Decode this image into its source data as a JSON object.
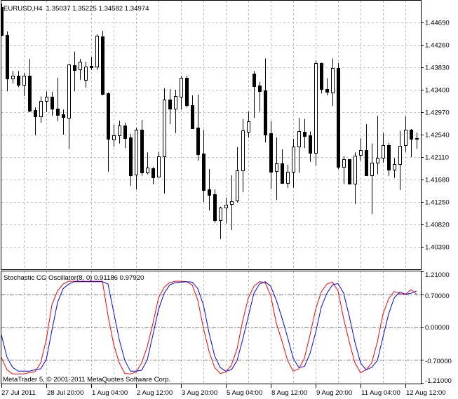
{
  "window": {
    "main_title": "EURUSD,H4  1.35037 1.35225 1.34582 1.34974",
    "indicator_title": "Stochastic CG Oscillator(8, 0) 0.91186 0.97920",
    "copyright": "MetaTrader 5, © 2001-2011 MetaQuotes Software Corp."
  },
  "colors": {
    "background": "#ffffff",
    "bull_body": "#ffffff",
    "bear_body": "#000000",
    "candle_outline": "#000000",
    "grid": "#c0c0c0",
    "level_lines": "#808080",
    "main_line": "#ff0000",
    "signal_line": "#0000ff"
  },
  "chart_data": [
    {
      "type": "candlestick",
      "symbol": "EURUSD",
      "timeframe": "H4",
      "grid": true,
      "y_axis_position": "right",
      "ylim": [
        1.4039,
        1.4512
      ],
      "y_ticks": [
        "1.44690",
        "1.44260",
        "1.43830",
        "1.43400",
        "1.42970",
        "1.42540",
        "1.42110",
        "1.41680",
        "1.41250",
        "1.40820",
        "1.40390"
      ],
      "x_ticks": [
        "27 Jul 2011",
        "28 Jul 20:00",
        "1 Aug 04:00",
        "2 Aug 12:00",
        "3 Aug 20:00",
        "5 Aug 04:00",
        "8 Aug 12:00",
        "9 Aug 20:00",
        "11 Aug 04:00",
        "12 Aug 12:00"
      ],
      "columns": [
        "open",
        "high",
        "low",
        "close"
      ],
      "candles": [
        [
          1.4499,
          1.4505,
          1.4443,
          1.4445
        ],
        [
          1.4445,
          1.4452,
          1.4337,
          1.4362
        ],
        [
          1.4362,
          1.4376,
          1.4352,
          1.4367
        ],
        [
          1.4367,
          1.4376,
          1.4345,
          1.4349
        ],
        [
          1.4349,
          1.4372,
          1.4328,
          1.4367
        ],
        [
          1.4367,
          1.4399,
          1.4297,
          1.43
        ],
        [
          1.4301,
          1.4306,
          1.4253,
          1.4289
        ],
        [
          1.4289,
          1.4327,
          1.4277,
          1.4319
        ],
        [
          1.4319,
          1.4337,
          1.4297,
          1.4327
        ],
        [
          1.4327,
          1.4336,
          1.429,
          1.4304
        ],
        [
          1.4304,
          1.4363,
          1.428,
          1.4292
        ],
        [
          1.4293,
          1.4302,
          1.4254,
          1.4288
        ],
        [
          1.4286,
          1.439,
          1.4227,
          1.4388
        ],
        [
          1.4387,
          1.4413,
          1.4337,
          1.4378
        ],
        [
          1.4379,
          1.4399,
          1.4359,
          1.4394
        ],
        [
          1.4359,
          1.4394,
          1.4344,
          1.4384
        ],
        [
          1.4386,
          1.4403,
          1.4378,
          1.4383
        ],
        [
          1.4384,
          1.4446,
          1.4378,
          1.4443
        ],
        [
          1.4442,
          1.4453,
          1.4329,
          1.4332
        ],
        [
          1.4333,
          1.4335,
          1.4183,
          1.4245
        ],
        [
          1.4245,
          1.4273,
          1.4231,
          1.4253
        ],
        [
          1.4252,
          1.4281,
          1.4237,
          1.4271
        ],
        [
          1.4271,
          1.4277,
          1.4228,
          1.4247
        ],
        [
          1.4249,
          1.4255,
          1.4156,
          1.4177
        ],
        [
          1.4177,
          1.4267,
          1.4149,
          1.4263
        ],
        [
          1.4263,
          1.4282,
          1.4175,
          1.4181
        ],
        [
          1.4181,
          1.422,
          1.4178,
          1.4191
        ],
        [
          1.419,
          1.4192,
          1.4159,
          1.4173
        ],
        [
          1.4173,
          1.4221,
          1.4172,
          1.4212
        ],
        [
          1.4212,
          1.4343,
          1.4141,
          1.4321
        ],
        [
          1.4321,
          1.4341,
          1.4274,
          1.4304
        ],
        [
          1.4304,
          1.434,
          1.4257,
          1.4328
        ],
        [
          1.4327,
          1.4366,
          1.4302,
          1.4363
        ],
        [
          1.4363,
          1.4367,
          1.4306,
          1.431
        ],
        [
          1.431,
          1.4329,
          1.4265,
          1.4266
        ],
        [
          1.4267,
          1.4331,
          1.4204,
          1.4216
        ],
        [
          1.4218,
          1.4263,
          1.4125,
          1.4148
        ],
        [
          1.4149,
          1.4188,
          1.4109,
          1.4138
        ],
        [
          1.414,
          1.4149,
          1.4085,
          1.409
        ],
        [
          1.409,
          1.4116,
          1.4054,
          1.4114
        ],
        [
          1.4113,
          1.4133,
          1.4084,
          1.4119
        ],
        [
          1.4121,
          1.4176,
          1.4071,
          1.4126
        ],
        [
          1.4128,
          1.423,
          1.4124,
          1.4186
        ],
        [
          1.4186,
          1.4284,
          1.4144,
          1.4262
        ],
        [
          1.426,
          1.4298,
          1.4248,
          1.428
        ],
        [
          1.4371,
          1.4376,
          1.4286,
          1.4347
        ],
        [
          1.4348,
          1.4355,
          1.4298,
          1.4337
        ],
        [
          1.4339,
          1.44,
          1.4239,
          1.4255
        ],
        [
          1.4257,
          1.428,
          1.415,
          1.4183
        ],
        [
          1.4184,
          1.4249,
          1.4129,
          1.4199
        ],
        [
          1.4199,
          1.4226,
          1.4161,
          1.4161
        ],
        [
          1.4162,
          1.4196,
          1.4152,
          1.4183
        ],
        [
          1.4183,
          1.4246,
          1.4152,
          1.4231
        ],
        [
          1.4231,
          1.4286,
          1.4181,
          1.4261
        ],
        [
          1.426,
          1.4284,
          1.4228,
          1.4252
        ],
        [
          1.4252,
          1.426,
          1.4202,
          1.4219
        ],
        [
          1.4219,
          1.4396,
          1.4195,
          1.4391
        ],
        [
          1.4391,
          1.4392,
          1.4333,
          1.4341
        ],
        [
          1.4341,
          1.4362,
          1.4329,
          1.4335
        ],
        [
          1.4335,
          1.44,
          1.4309,
          1.4382
        ],
        [
          1.4382,
          1.4391,
          1.4188,
          1.4192
        ],
        [
          1.4192,
          1.4213,
          1.416,
          1.4207
        ],
        [
          1.4207,
          1.4207,
          1.416,
          1.416
        ],
        [
          1.416,
          1.422,
          1.4121,
          1.4214
        ],
        [
          1.4214,
          1.4247,
          1.4204,
          1.4224
        ],
        [
          1.4224,
          1.4274,
          1.4175,
          1.4176
        ],
        [
          1.4176,
          1.4237,
          1.4102,
          1.42
        ],
        [
          1.42,
          1.429,
          1.4178,
          1.421
        ],
        [
          1.421,
          1.4257,
          1.42,
          1.4234
        ],
        [
          1.4234,
          1.4238,
          1.4175,
          1.4187
        ],
        [
          1.4187,
          1.4209,
          1.4171,
          1.4198
        ],
        [
          1.4198,
          1.4261,
          1.4148,
          1.4233
        ],
        [
          1.4233,
          1.4289,
          1.4221,
          1.4263
        ],
        [
          1.4263,
          1.4265,
          1.4211,
          1.4245
        ],
        [
          1.4247,
          1.4258,
          1.4227,
          1.4246
        ]
      ]
    },
    {
      "type": "line",
      "title": "Stochastic CG Oscillator(8, 0)",
      "grid": true,
      "y_axis_position": "right",
      "ylim": [
        -1.21,
        1.21
      ],
      "y_ticks": [
        "1.21000",
        "0.70000",
        "0.00000",
        "-0.70000",
        "-1.21000"
      ],
      "levels": [
        0.7,
        0.0,
        -0.7
      ],
      "series": [
        {
          "color": "#ff0000",
          "values": [
            -0.66,
            -0.92,
            -1.01,
            -1.01,
            -1.01,
            -0.98,
            -0.96,
            -0.77,
            -0.27,
            0.48,
            0.78,
            0.93,
            0.99,
            0.99,
            0.99,
            0.99,
            0.99,
            0.99,
            0.99,
            0.25,
            -0.37,
            -0.77,
            -1.0,
            -1.01,
            -0.97,
            -0.77,
            -0.42,
            0.08,
            0.63,
            0.86,
            0.96,
            0.99,
            0.99,
            0.98,
            0.91,
            0.58,
            -0.02,
            -0.52,
            -0.87,
            -1.0,
            -0.97,
            -0.82,
            -0.47,
            0.13,
            0.63,
            0.88,
            0.98,
            0.96,
            0.68,
            0.08,
            -0.3,
            -0.72,
            -0.95,
            -0.9,
            -0.67,
            -0.17,
            0.38,
            0.76,
            0.93,
            0.97,
            0.78,
            0.18,
            -0.32,
            -0.77,
            -0.98,
            -0.92,
            -0.77,
            -0.32,
            0.28,
            0.61,
            0.77,
            0.72,
            0.71,
            0.81,
            0.71
          ]
        },
        {
          "color": "#0000ff",
          "values": [
            -0.17,
            -0.65,
            -0.87,
            -0.95,
            -0.95,
            -0.95,
            -0.92,
            -0.9,
            -0.7,
            -0.07,
            0.53,
            0.83,
            0.93,
            0.98,
            0.98,
            0.98,
            0.98,
            0.98,
            0.98,
            0.93,
            0.33,
            -0.27,
            -0.72,
            -0.95,
            -0.95,
            -0.93,
            -0.7,
            -0.17,
            0.38,
            0.73,
            0.91,
            0.96,
            0.97,
            0.98,
            0.97,
            0.83,
            0.48,
            -0.12,
            -0.62,
            -0.87,
            -0.95,
            -0.92,
            -0.72,
            -0.27,
            0.23,
            0.73,
            0.93,
            0.98,
            0.88,
            0.58,
            0.2,
            -0.22,
            -0.67,
            -0.87,
            -0.85,
            -0.57,
            -0.12,
            0.43,
            0.73,
            0.91,
            0.94,
            0.73,
            0.23,
            -0.32,
            -0.77,
            -0.92,
            -0.87,
            -0.72,
            -0.22,
            0.28,
            0.63,
            0.76,
            0.71,
            0.73,
            0.78
          ]
        }
      ]
    }
  ]
}
